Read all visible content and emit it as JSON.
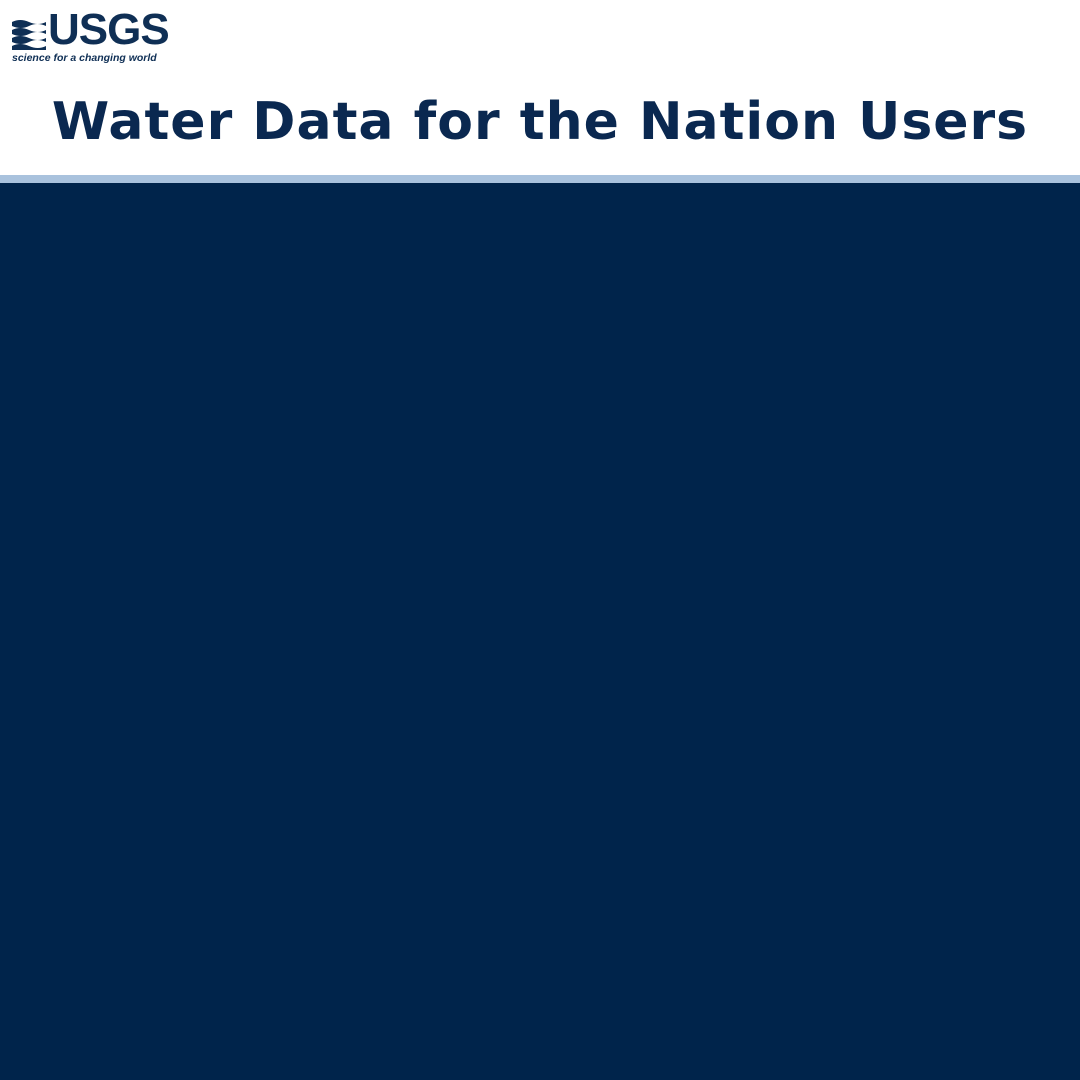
{
  "header": {
    "logo": {
      "wordmark": "USGS",
      "tagline": "science for a changing world",
      "icon": "usgs-wave-logo-icon"
    },
    "title": "Water Data for the Nation Users"
  },
  "colors": {
    "brand_navy": "#0a2850",
    "divider": "#a9c2dd",
    "panel": "#00244b",
    "background": "#ffffff"
  }
}
